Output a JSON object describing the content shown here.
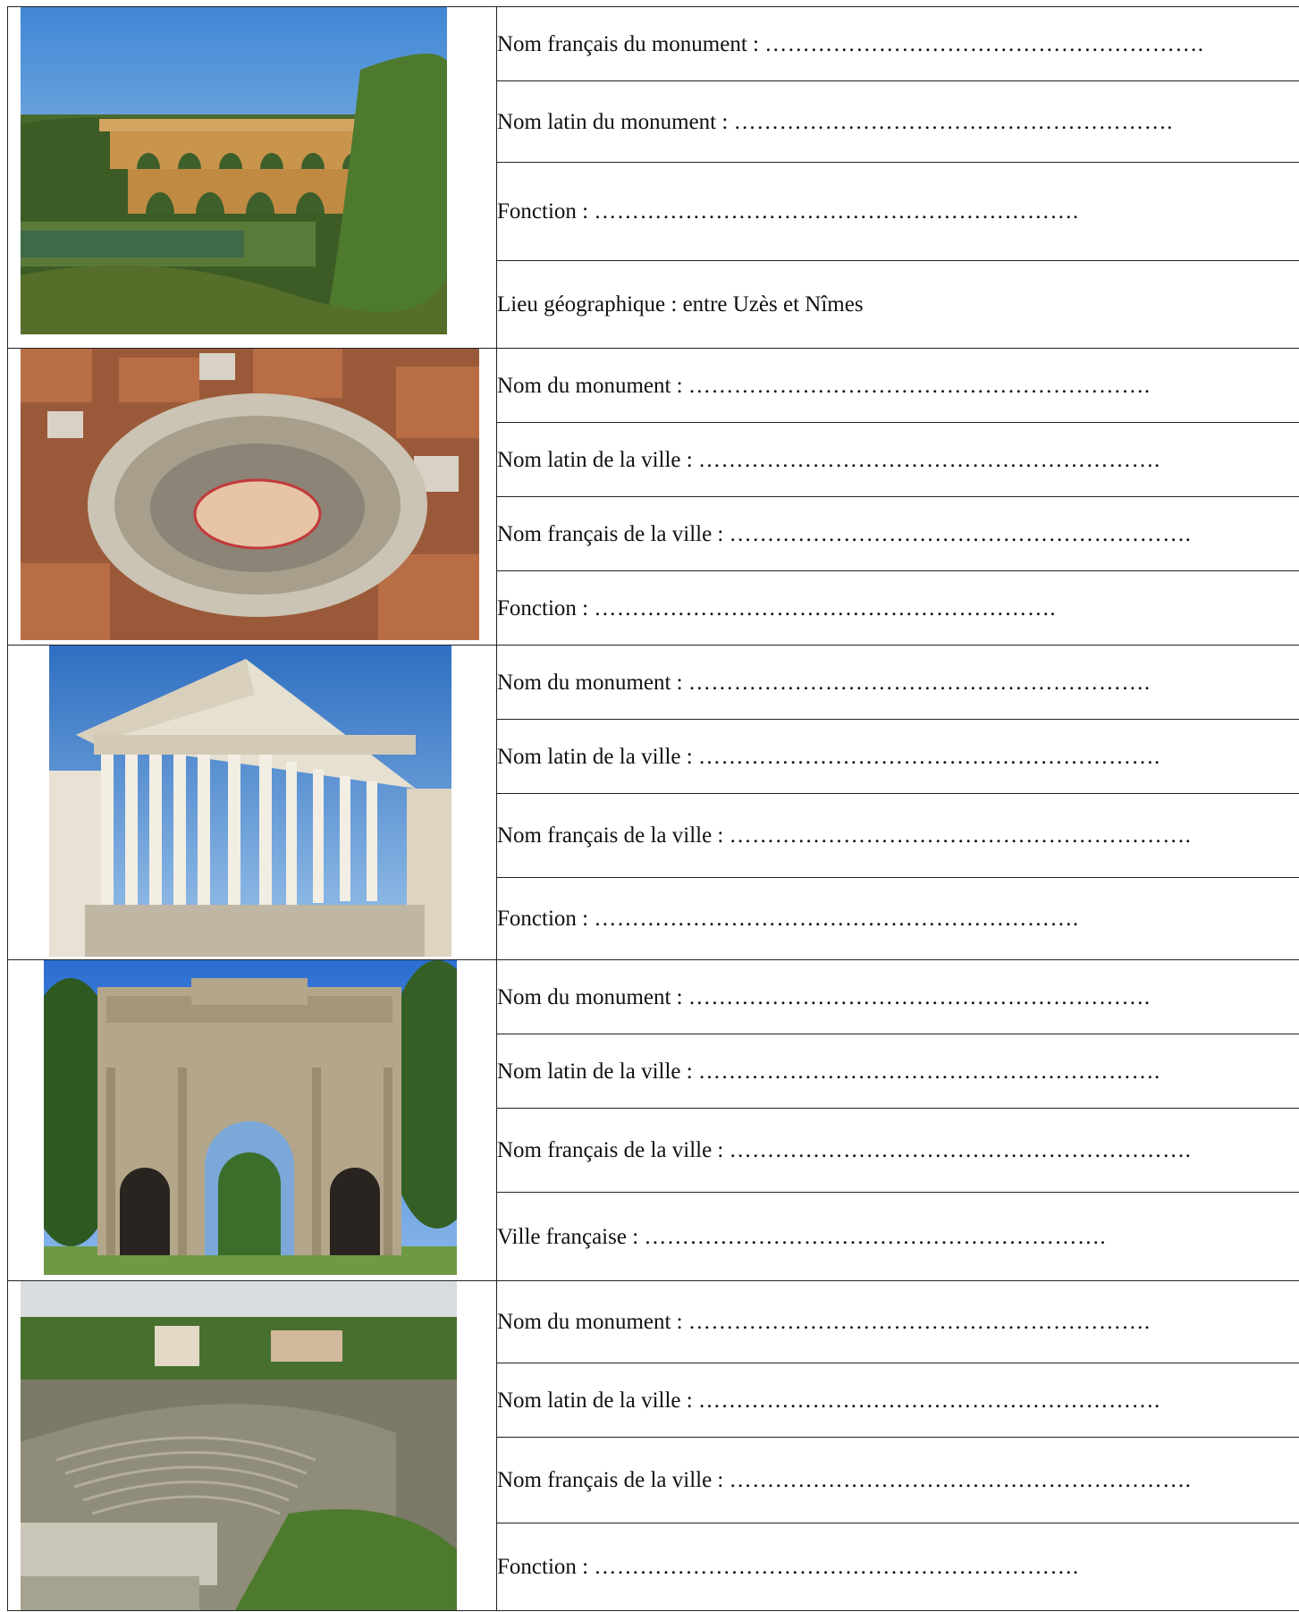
{
  "monuments": [
    {
      "image_label": "Pont du Gard aqueduct photo",
      "fields": [
        {
          "label": "Nom français du monument :",
          "dots": "…………………………………………………."
        },
        {
          "label": "Nom latin du monument :",
          "dots": "…………………………………………………."
        },
        {
          "label": "Fonction :",
          "dots": "………………………………………………………."
        },
        {
          "label": "Lieu géographique : entre Uzès et Nîmes",
          "dots": ""
        }
      ]
    },
    {
      "image_label": "Amphitheatre aerial photo",
      "fields": [
        {
          "label": "Nom du monument :",
          "dots": "……………………………………………………."
        },
        {
          "label": "Nom latin de la ville :",
          "dots": "……………………………………………………."
        },
        {
          "label": "Nom français de la ville :",
          "dots": "……………………………………………………."
        },
        {
          "label": "Fonction :",
          "dots": "……………………………………………………."
        }
      ]
    },
    {
      "image_label": "Roman temple photo",
      "fields": [
        {
          "label": "Nom du monument :",
          "dots": "……………………………………………………."
        },
        {
          "label": "Nom latin de la ville :",
          "dots": "……………………………………………………."
        },
        {
          "label": "Nom français de la ville :",
          "dots": "……………………………………………………."
        },
        {
          "label": "Fonction :",
          "dots": "………………………………………………………."
        }
      ]
    },
    {
      "image_label": "Triumphal arch photo",
      "fields": [
        {
          "label": "Nom du monument :",
          "dots": "……………………………………………………."
        },
        {
          "label": "Nom latin de la ville :",
          "dots": "……………………………………………………."
        },
        {
          "label": "Nom français de la ville :",
          "dots": "……………………………………………………."
        },
        {
          "label": "Ville française :",
          "dots": "……………………………………………………."
        }
      ]
    },
    {
      "image_label": "Roman theatre photo",
      "fields": [
        {
          "label": "Nom du monument :",
          "dots": "……………………………………………………."
        },
        {
          "label": "Nom latin de la ville :",
          "dots": "……………………………………………………."
        },
        {
          "label": "Nom français de la ville :",
          "dots": "……………………………………………………."
        },
        {
          "label": "Fonction :",
          "dots": "………………………………………………………."
        }
      ]
    }
  ]
}
